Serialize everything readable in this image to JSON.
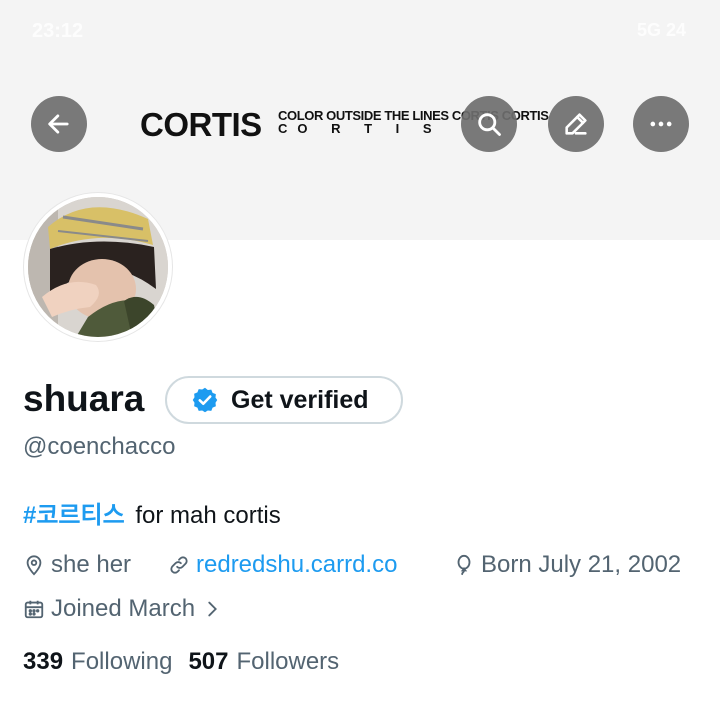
{
  "status_bar": {
    "time": "23:12",
    "right": "5G 24"
  },
  "banner": {
    "logo": "CORTIS",
    "line1": "COLOR OUTSIDE THE LINES CORTIS CORTIS",
    "line2": "CO R T I S"
  },
  "header": {
    "back_icon": "arrow-left-icon",
    "search_icon": "search-icon",
    "edit_icon": "edit-icon",
    "more_icon": "more-horizontal-icon"
  },
  "profile": {
    "name": "shuara",
    "verify_label": "Get verified",
    "handle": "@coenchacco",
    "bio_hashtag": "#코르티스",
    "bio_text": "for mah cortis",
    "location": "she her",
    "website": "redredshu.carrd.co",
    "birthday": "Born July 21, 2002",
    "joined": "Joined March"
  },
  "stats": {
    "following_count": "339",
    "following_label": "Following",
    "followers_count": "507",
    "followers_label": "Followers"
  },
  "colors": {
    "accent": "#1d9bf0",
    "secondary_text": "#536471",
    "button_overlay": "#6e6e6e"
  }
}
